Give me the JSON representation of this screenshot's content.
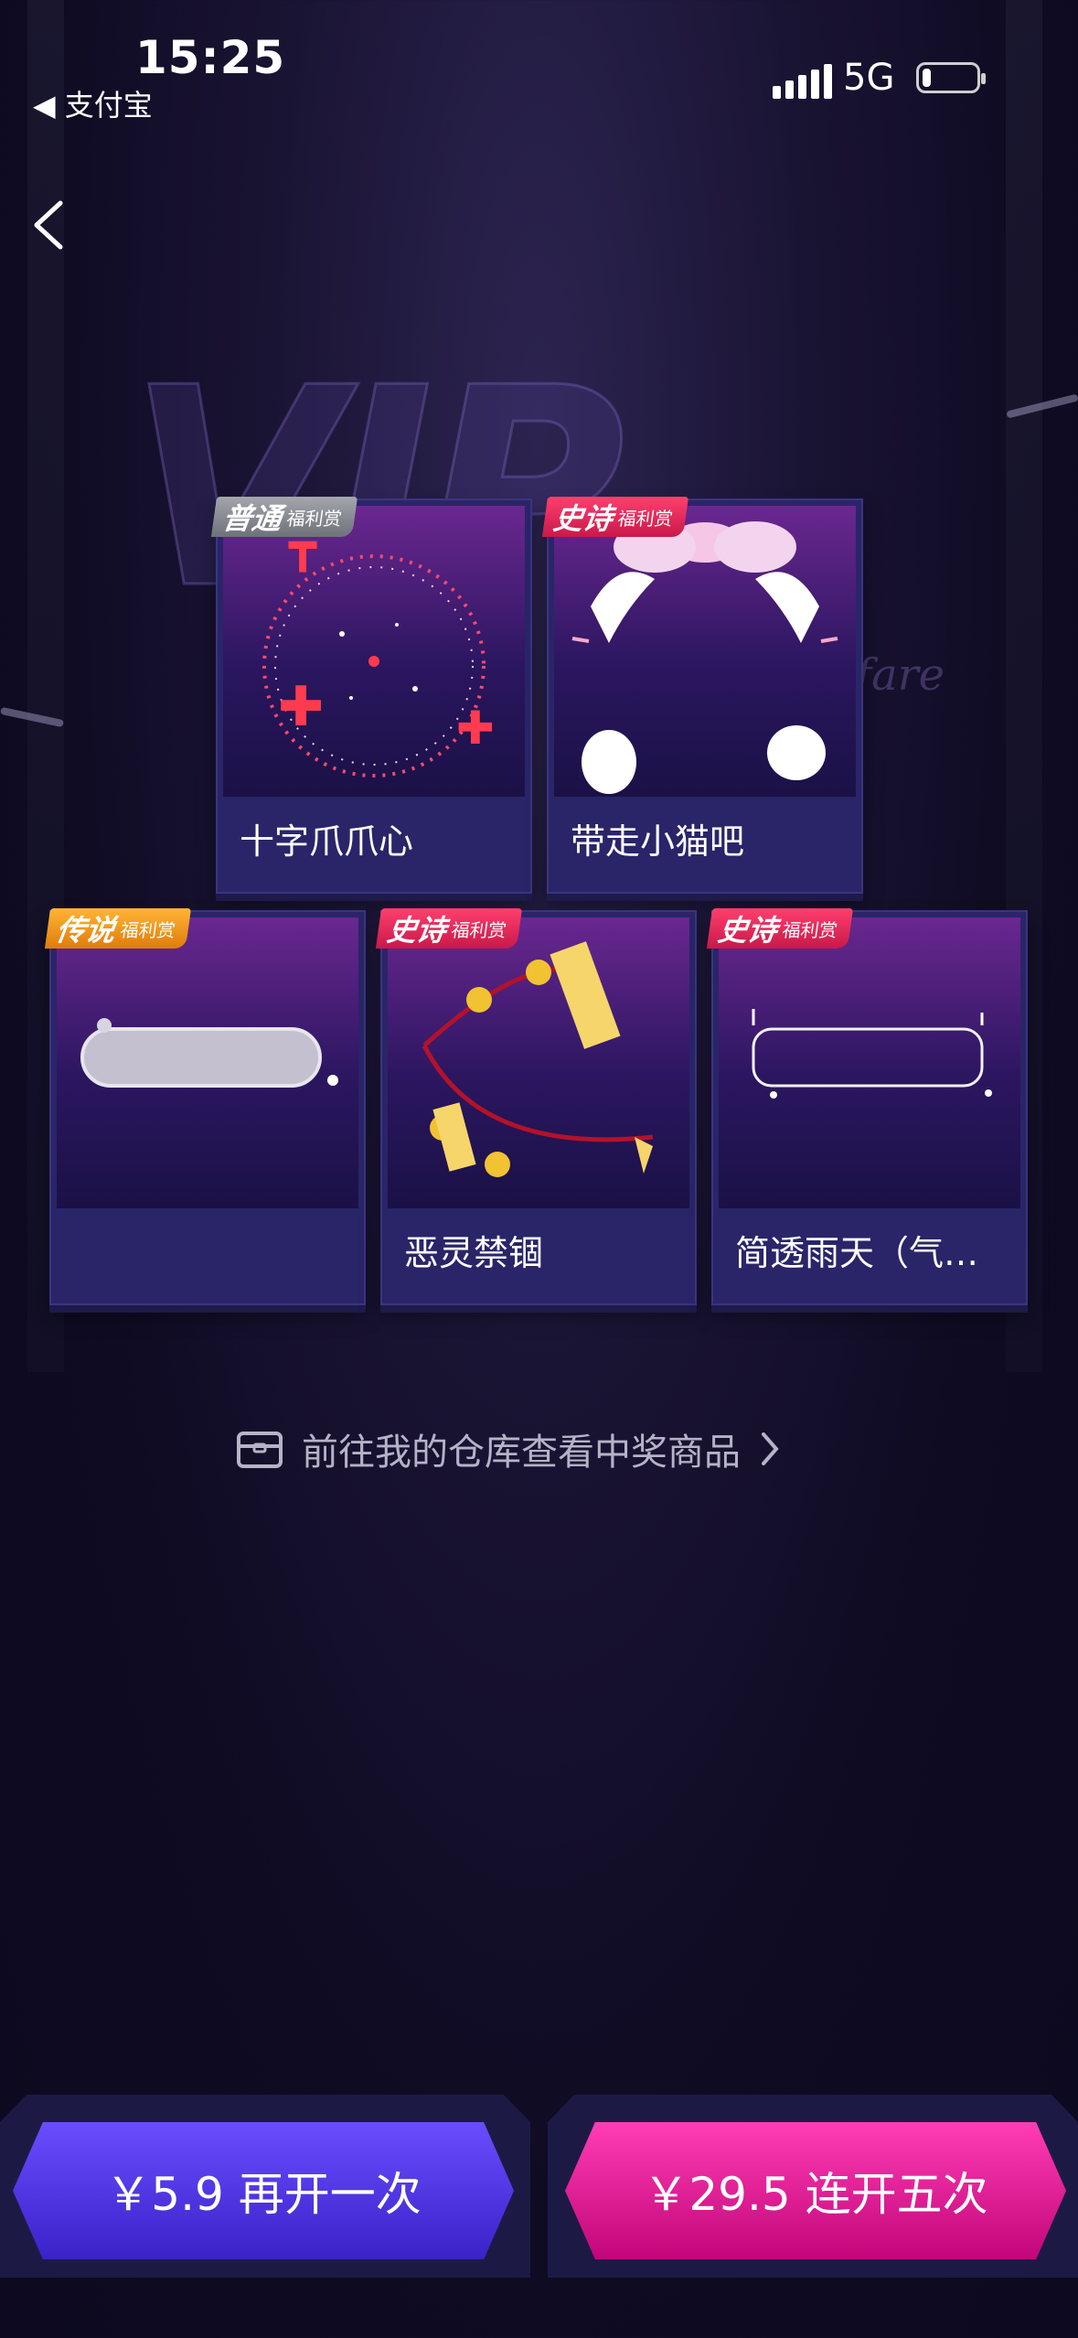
{
  "status_bar": {
    "time": "15:25",
    "back_app": "◀ 支付宝",
    "network": "5G",
    "battery_level": 0.15
  },
  "cards": [
    {
      "badge_main": "普通",
      "badge_sub": "福利赏",
      "badge_type": "common",
      "name": "十字爪爪心"
    },
    {
      "badge_main": "史诗",
      "badge_sub": "福利赏",
      "badge_type": "epic",
      "name": "带走小猫吧"
    },
    {
      "badge_main": "传说",
      "badge_sub": "福利赏",
      "badge_type": "legend",
      "name": ""
    },
    {
      "badge_main": "史诗",
      "badge_sub": "福利赏",
      "badge_type": "epic",
      "name": "恶灵禁锢"
    },
    {
      "badge_main": "史诗",
      "badge_sub": "福利赏",
      "badge_type": "epic",
      "name": "简透雨天（气…"
    }
  ],
  "warehouse_link": "前往我的仓库查看中奖商品",
  "buttons": {
    "open_once": "￥5.9 再开一次",
    "open_five": "￥29.5 连开五次"
  },
  "background_text": {
    "welfare": "lfare"
  },
  "colors": {
    "epic": "#e0245e",
    "common": "#8c8e96",
    "legend": "#f39a1c",
    "button_once": "#4b34e0",
    "button_five": "#e2178f"
  }
}
